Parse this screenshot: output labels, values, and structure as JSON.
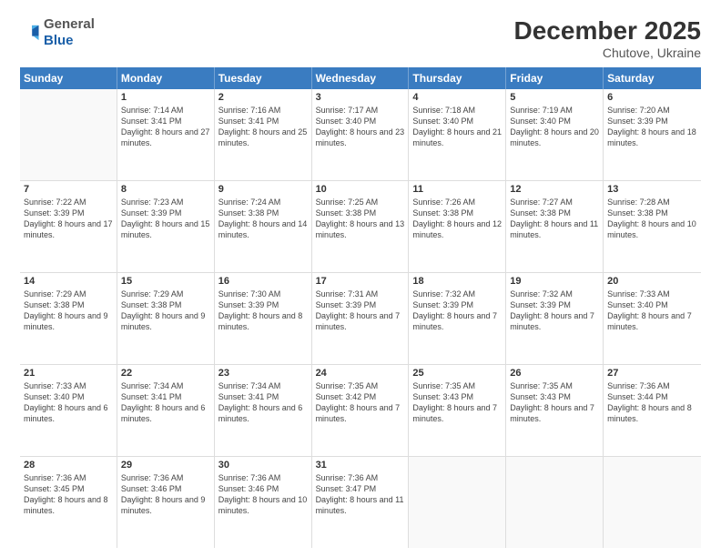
{
  "logo": {
    "general": "General",
    "blue": "Blue"
  },
  "title": "December 2025",
  "subtitle": "Chutove, Ukraine",
  "header_days": [
    "Sunday",
    "Monday",
    "Tuesday",
    "Wednesday",
    "Thursday",
    "Friday",
    "Saturday"
  ],
  "weeks": [
    [
      {
        "day": "",
        "sunrise": "",
        "sunset": "",
        "daylight": ""
      },
      {
        "day": "1",
        "sunrise": "Sunrise: 7:14 AM",
        "sunset": "Sunset: 3:41 PM",
        "daylight": "Daylight: 8 hours and 27 minutes."
      },
      {
        "day": "2",
        "sunrise": "Sunrise: 7:16 AM",
        "sunset": "Sunset: 3:41 PM",
        "daylight": "Daylight: 8 hours and 25 minutes."
      },
      {
        "day": "3",
        "sunrise": "Sunrise: 7:17 AM",
        "sunset": "Sunset: 3:40 PM",
        "daylight": "Daylight: 8 hours and 23 minutes."
      },
      {
        "day": "4",
        "sunrise": "Sunrise: 7:18 AM",
        "sunset": "Sunset: 3:40 PM",
        "daylight": "Daylight: 8 hours and 21 minutes."
      },
      {
        "day": "5",
        "sunrise": "Sunrise: 7:19 AM",
        "sunset": "Sunset: 3:40 PM",
        "daylight": "Daylight: 8 hours and 20 minutes."
      },
      {
        "day": "6",
        "sunrise": "Sunrise: 7:20 AM",
        "sunset": "Sunset: 3:39 PM",
        "daylight": "Daylight: 8 hours and 18 minutes."
      }
    ],
    [
      {
        "day": "7",
        "sunrise": "Sunrise: 7:22 AM",
        "sunset": "Sunset: 3:39 PM",
        "daylight": "Daylight: 8 hours and 17 minutes."
      },
      {
        "day": "8",
        "sunrise": "Sunrise: 7:23 AM",
        "sunset": "Sunset: 3:39 PM",
        "daylight": "Daylight: 8 hours and 15 minutes."
      },
      {
        "day": "9",
        "sunrise": "Sunrise: 7:24 AM",
        "sunset": "Sunset: 3:38 PM",
        "daylight": "Daylight: 8 hours and 14 minutes."
      },
      {
        "day": "10",
        "sunrise": "Sunrise: 7:25 AM",
        "sunset": "Sunset: 3:38 PM",
        "daylight": "Daylight: 8 hours and 13 minutes."
      },
      {
        "day": "11",
        "sunrise": "Sunrise: 7:26 AM",
        "sunset": "Sunset: 3:38 PM",
        "daylight": "Daylight: 8 hours and 12 minutes."
      },
      {
        "day": "12",
        "sunrise": "Sunrise: 7:27 AM",
        "sunset": "Sunset: 3:38 PM",
        "daylight": "Daylight: 8 hours and 11 minutes."
      },
      {
        "day": "13",
        "sunrise": "Sunrise: 7:28 AM",
        "sunset": "Sunset: 3:38 PM",
        "daylight": "Daylight: 8 hours and 10 minutes."
      }
    ],
    [
      {
        "day": "14",
        "sunrise": "Sunrise: 7:29 AM",
        "sunset": "Sunset: 3:38 PM",
        "daylight": "Daylight: 8 hours and 9 minutes."
      },
      {
        "day": "15",
        "sunrise": "Sunrise: 7:29 AM",
        "sunset": "Sunset: 3:38 PM",
        "daylight": "Daylight: 8 hours and 9 minutes."
      },
      {
        "day": "16",
        "sunrise": "Sunrise: 7:30 AM",
        "sunset": "Sunset: 3:39 PM",
        "daylight": "Daylight: 8 hours and 8 minutes."
      },
      {
        "day": "17",
        "sunrise": "Sunrise: 7:31 AM",
        "sunset": "Sunset: 3:39 PM",
        "daylight": "Daylight: 8 hours and 7 minutes."
      },
      {
        "day": "18",
        "sunrise": "Sunrise: 7:32 AM",
        "sunset": "Sunset: 3:39 PM",
        "daylight": "Daylight: 8 hours and 7 minutes."
      },
      {
        "day": "19",
        "sunrise": "Sunrise: 7:32 AM",
        "sunset": "Sunset: 3:39 PM",
        "daylight": "Daylight: 8 hours and 7 minutes."
      },
      {
        "day": "20",
        "sunrise": "Sunrise: 7:33 AM",
        "sunset": "Sunset: 3:40 PM",
        "daylight": "Daylight: 8 hours and 7 minutes."
      }
    ],
    [
      {
        "day": "21",
        "sunrise": "Sunrise: 7:33 AM",
        "sunset": "Sunset: 3:40 PM",
        "daylight": "Daylight: 8 hours and 6 minutes."
      },
      {
        "day": "22",
        "sunrise": "Sunrise: 7:34 AM",
        "sunset": "Sunset: 3:41 PM",
        "daylight": "Daylight: 8 hours and 6 minutes."
      },
      {
        "day": "23",
        "sunrise": "Sunrise: 7:34 AM",
        "sunset": "Sunset: 3:41 PM",
        "daylight": "Daylight: 8 hours and 6 minutes."
      },
      {
        "day": "24",
        "sunrise": "Sunrise: 7:35 AM",
        "sunset": "Sunset: 3:42 PM",
        "daylight": "Daylight: 8 hours and 7 minutes."
      },
      {
        "day": "25",
        "sunrise": "Sunrise: 7:35 AM",
        "sunset": "Sunset: 3:43 PM",
        "daylight": "Daylight: 8 hours and 7 minutes."
      },
      {
        "day": "26",
        "sunrise": "Sunrise: 7:35 AM",
        "sunset": "Sunset: 3:43 PM",
        "daylight": "Daylight: 8 hours and 7 minutes."
      },
      {
        "day": "27",
        "sunrise": "Sunrise: 7:36 AM",
        "sunset": "Sunset: 3:44 PM",
        "daylight": "Daylight: 8 hours and 8 minutes."
      }
    ],
    [
      {
        "day": "28",
        "sunrise": "Sunrise: 7:36 AM",
        "sunset": "Sunset: 3:45 PM",
        "daylight": "Daylight: 8 hours and 8 minutes."
      },
      {
        "day": "29",
        "sunrise": "Sunrise: 7:36 AM",
        "sunset": "Sunset: 3:46 PM",
        "daylight": "Daylight: 8 hours and 9 minutes."
      },
      {
        "day": "30",
        "sunrise": "Sunrise: 7:36 AM",
        "sunset": "Sunset: 3:46 PM",
        "daylight": "Daylight: 8 hours and 10 minutes."
      },
      {
        "day": "31",
        "sunrise": "Sunrise: 7:36 AM",
        "sunset": "Sunset: 3:47 PM",
        "daylight": "Daylight: 8 hours and 11 minutes."
      },
      {
        "day": "",
        "sunrise": "",
        "sunset": "",
        "daylight": ""
      },
      {
        "day": "",
        "sunrise": "",
        "sunset": "",
        "daylight": ""
      },
      {
        "day": "",
        "sunrise": "",
        "sunset": "",
        "daylight": ""
      }
    ]
  ]
}
